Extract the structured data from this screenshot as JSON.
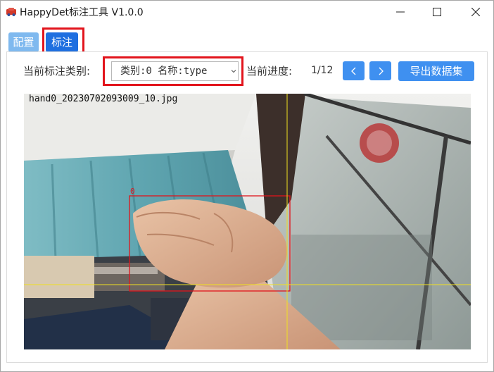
{
  "window": {
    "title": "HappyDet标注工具 V1.0.0",
    "controls": [
      "minimize-icon",
      "maximize-icon",
      "close-icon"
    ]
  },
  "tabs": [
    {
      "label": "配置",
      "active": false
    },
    {
      "label": "标注",
      "active": true
    }
  ],
  "toolbar": {
    "category_label": "当前标注类别:",
    "category_select_value": "类别:0 名称:type",
    "progress_label": "当前进度:",
    "progress_value": "1/12",
    "prev_icon": "chevron-left-icon",
    "next_icon": "chevron-right-icon",
    "export_label": "导出数据集"
  },
  "image": {
    "filename": "hand0_20230702093009_10.jpg",
    "box_label": "0"
  },
  "colors": {
    "primary_button": "#3f90f0",
    "active_tab": "#1e6fe0",
    "inactive_tab": "#7fb9ef",
    "highlight": "#e2141c",
    "bbox": "#e0141c",
    "crosshair": "#f0e020"
  }
}
